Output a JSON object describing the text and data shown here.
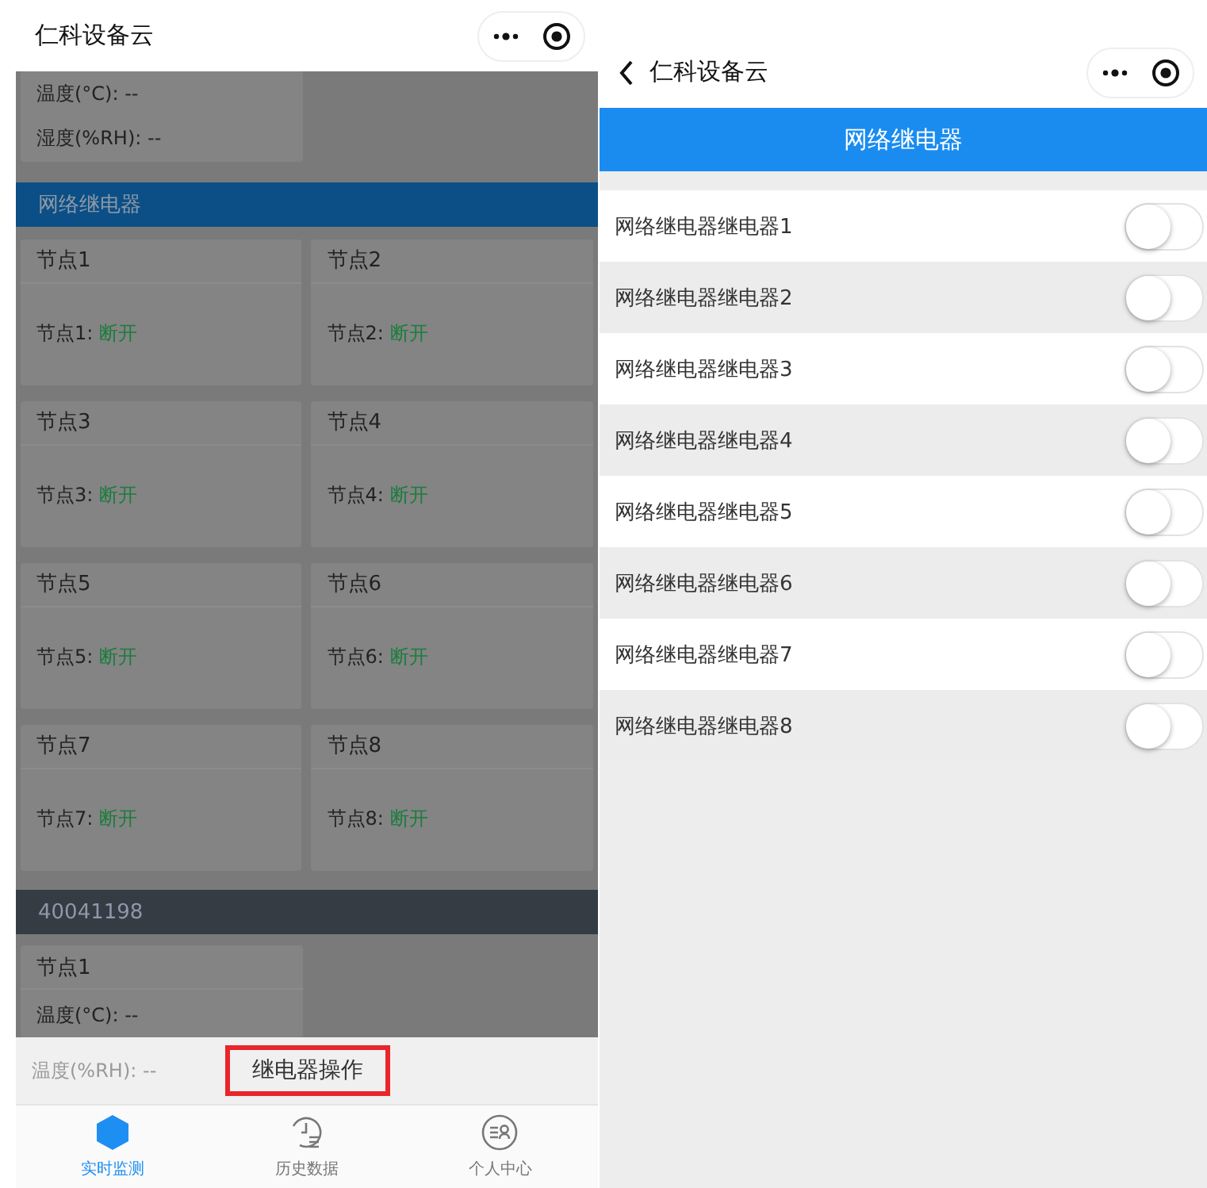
{
  "left_screen": {
    "title": "仁科设备云",
    "top_card": {
      "lines": [
        "温度(°C): --",
        "湿度(%RH): --"
      ]
    },
    "sections": [
      {
        "kind": "relay",
        "title": "网络继电器",
        "nodes": [
          {
            "title": "节点1",
            "label": "节点1: ",
            "status": "断开"
          },
          {
            "title": "节点2",
            "label": "节点2: ",
            "status": "断开"
          },
          {
            "title": "节点3",
            "label": "节点3: ",
            "status": "断开"
          },
          {
            "title": "节点4",
            "label": "节点4: ",
            "status": "断开"
          },
          {
            "title": "节点5",
            "label": "节点5: ",
            "status": "断开"
          },
          {
            "title": "节点6",
            "label": "节点6: ",
            "status": "断开"
          },
          {
            "title": "节点7",
            "label": "节点7: ",
            "status": "断开"
          },
          {
            "title": "节点8",
            "label": "节点8: ",
            "status": "断开"
          }
        ]
      },
      {
        "kind": "sensor",
        "title": "40041198",
        "nodes": [
          {
            "title": "节点1",
            "lines": [
              "温度(°C): --"
            ]
          }
        ]
      }
    ],
    "action_sheet": {
      "faded_text": "温度(%RH): --",
      "option": "继电器操作",
      "highlighted": true
    },
    "tabs": [
      {
        "label": "实时监测",
        "kind": "monitor",
        "selected": true
      },
      {
        "label": "历史数据",
        "kind": "history",
        "selected": false
      },
      {
        "label": "个人中心",
        "kind": "profile",
        "selected": false
      }
    ]
  },
  "right_screen": {
    "title": "仁科设备云",
    "header": "网络继电器",
    "relays": [
      {
        "label": "网络继电器继电器1",
        "on": false
      },
      {
        "label": "网络继电器继电器2",
        "on": false
      },
      {
        "label": "网络继电器继电器3",
        "on": false
      },
      {
        "label": "网络继电器继电器4",
        "on": false
      },
      {
        "label": "网络继电器继电器5",
        "on": false
      },
      {
        "label": "网络继电器继电器6",
        "on": false
      },
      {
        "label": "网络继电器继电器7",
        "on": false
      },
      {
        "label": "网络继电器继电器8",
        "on": false
      }
    ]
  }
}
